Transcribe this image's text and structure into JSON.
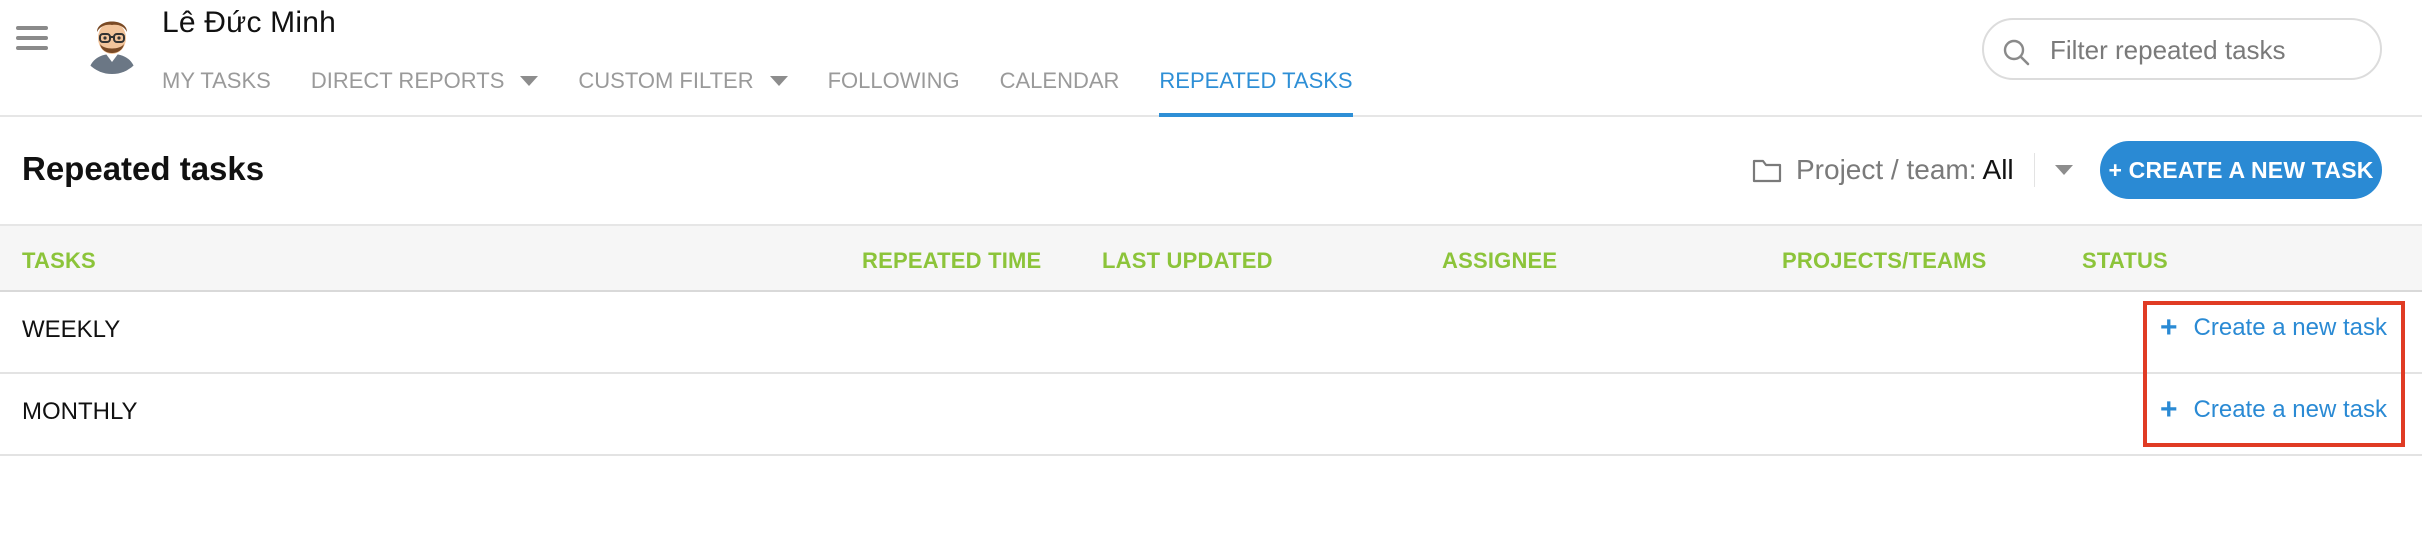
{
  "header": {
    "user_name": "Lê Đức Minh",
    "nav": [
      {
        "label": "MY TASKS",
        "has_dropdown": false,
        "active": false
      },
      {
        "label": "DIRECT REPORTS",
        "has_dropdown": true,
        "active": false
      },
      {
        "label": "CUSTOM FILTER",
        "has_dropdown": true,
        "active": false
      },
      {
        "label": "FOLLOWING",
        "has_dropdown": false,
        "active": false
      },
      {
        "label": "CALENDAR",
        "has_dropdown": false,
        "active": false
      },
      {
        "label": "REPEATED TASKS",
        "has_dropdown": false,
        "active": true
      }
    ],
    "search": {
      "placeholder": "Filter repeated tasks",
      "value": ""
    }
  },
  "page": {
    "title": "Repeated tasks",
    "filter_label": "Project / team:",
    "filter_value": "All",
    "create_button_label": "+ CREATE A NEW TASK"
  },
  "table": {
    "columns": [
      "TASKS",
      "REPEATED TIME",
      "LAST UPDATED",
      "ASSIGNEE",
      "PROJECTS/TEAMS",
      "STATUS"
    ],
    "rows": [
      {
        "name": "WEEKLY",
        "action_plus": "+",
        "action_label": "Create a new task"
      },
      {
        "name": "MONTHLY",
        "action_plus": "+",
        "action_label": "Create a new task"
      }
    ]
  },
  "colors": {
    "accent": "#2a8ad4",
    "column_header": "#8cc43a",
    "highlight": "#e03b24"
  },
  "icons": [
    "hamburger-menu-icon",
    "user-avatar",
    "caret-down-icon",
    "search-icon",
    "folder-icon"
  ]
}
